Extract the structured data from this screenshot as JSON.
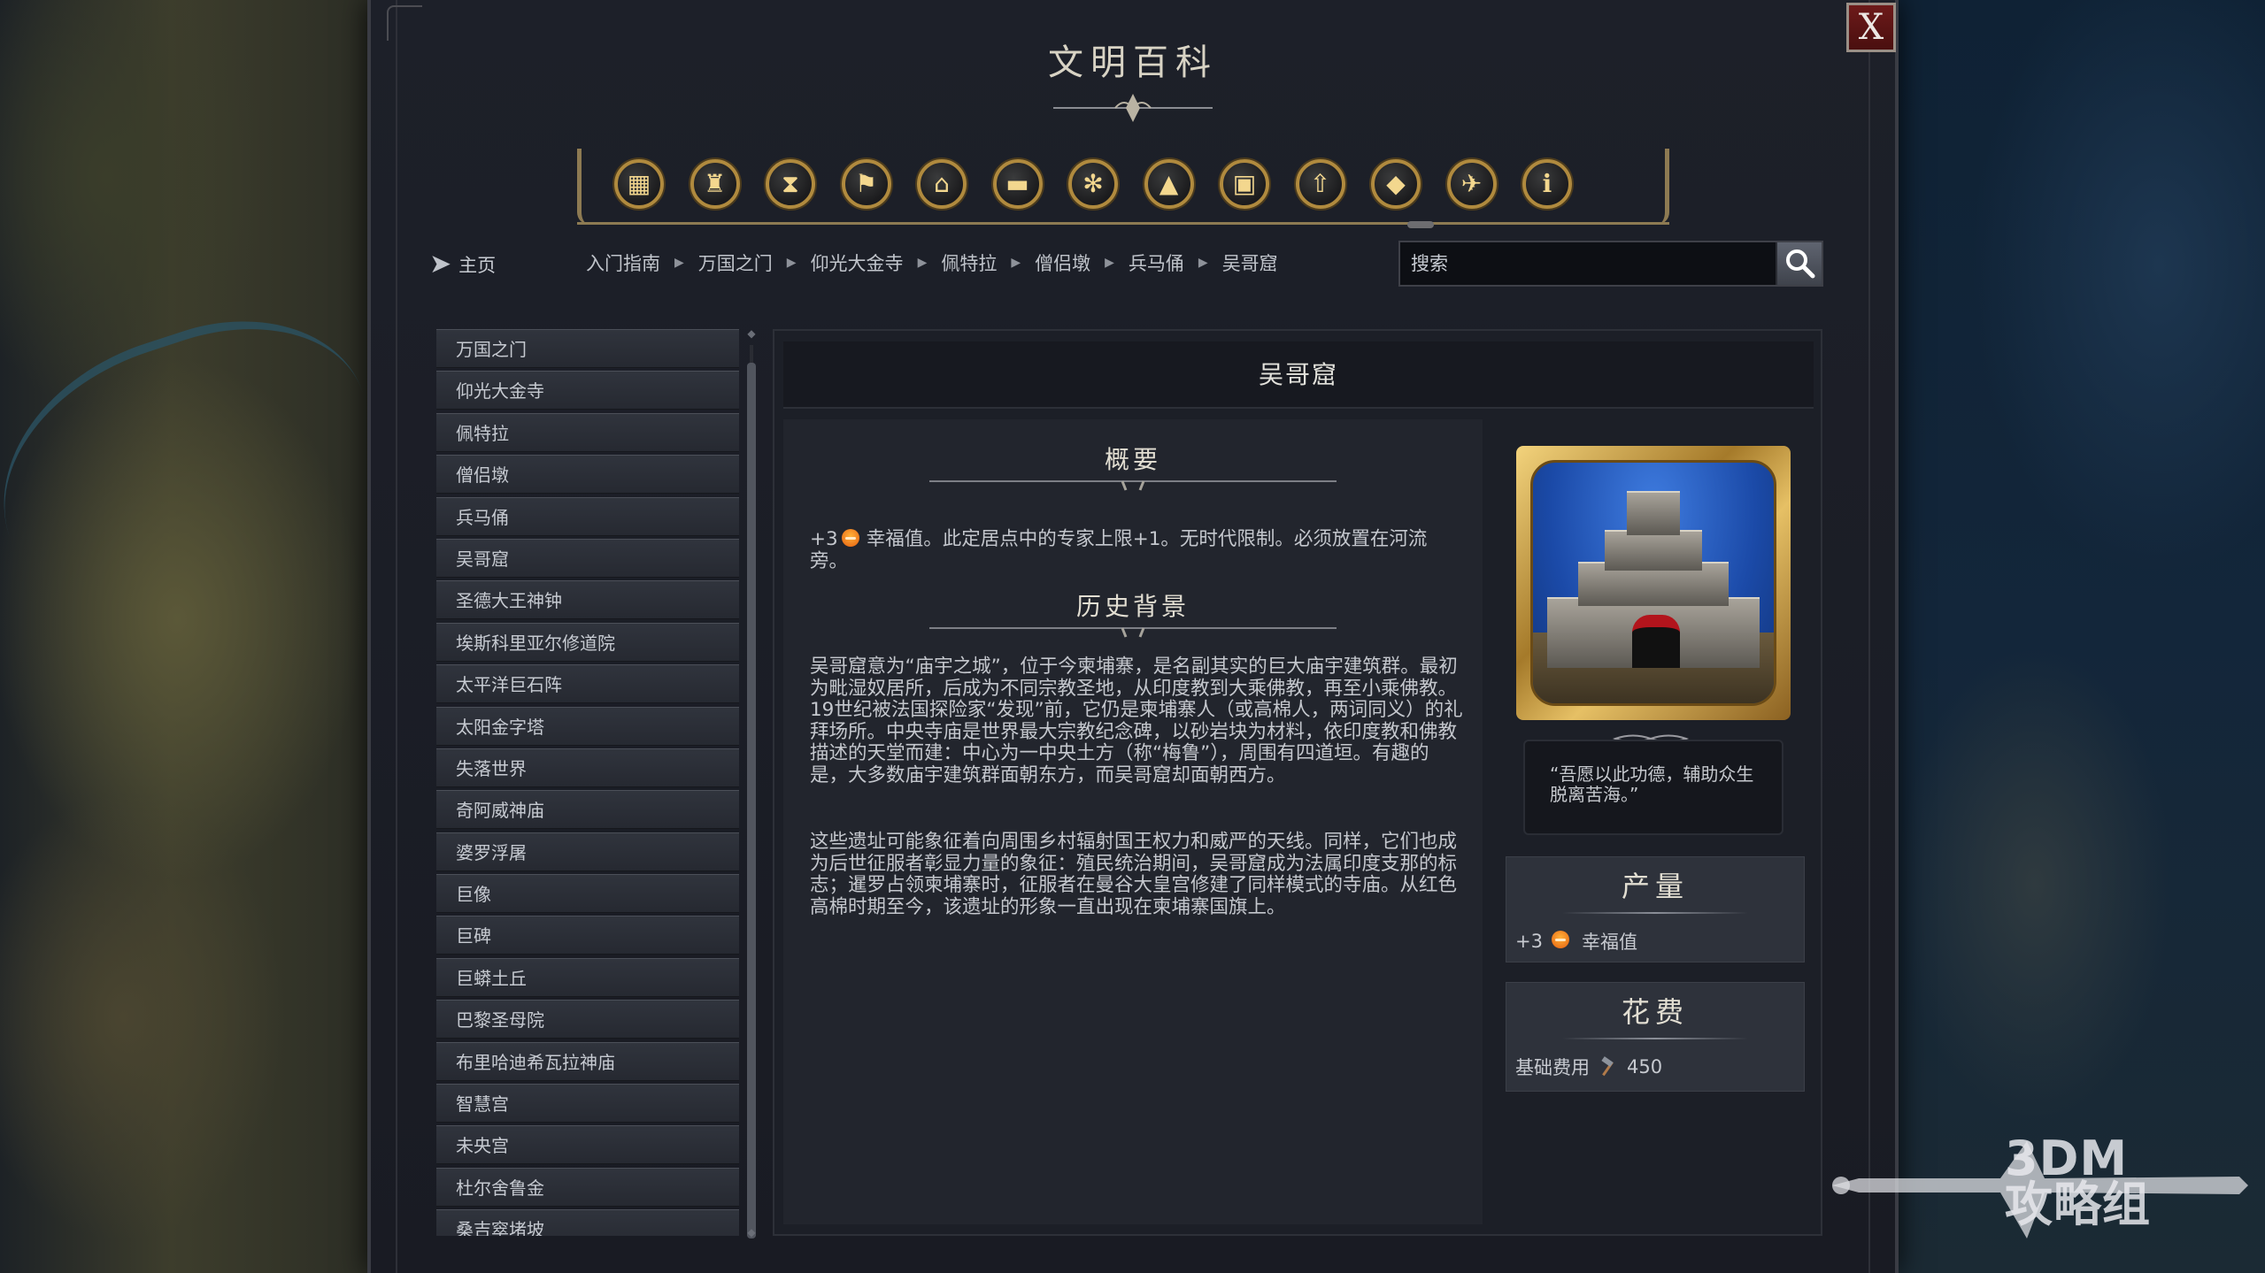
{
  "window": {
    "title": "文明百科",
    "close_label": "X"
  },
  "toolbar": {
    "categories": [
      {
        "icon": "civilization-crate-icon",
        "glyph": "▦"
      },
      {
        "icon": "leader-goblet-icon",
        "glyph": "♜"
      },
      {
        "icon": "era-hourglass-icon",
        "glyph": "⧗"
      },
      {
        "icon": "district-flag-icon",
        "glyph": "⚑"
      },
      {
        "icon": "building-temple-icon",
        "glyph": "⌂"
      },
      {
        "icon": "knowledge-book-icon",
        "glyph": "▬"
      },
      {
        "icon": "culture-emblem-icon",
        "glyph": "✻"
      },
      {
        "icon": "terrain-mountain-icon",
        "glyph": "▲"
      },
      {
        "icon": "city-tower-icon",
        "glyph": "▣"
      },
      {
        "icon": "upgrade-arrow-icon",
        "glyph": "⇧"
      },
      {
        "icon": "wonder-book-icon",
        "glyph": "◆"
      },
      {
        "icon": "dove-icon",
        "glyph": "✈"
      },
      {
        "icon": "info-icon",
        "glyph": "ℹ"
      }
    ],
    "selected_index": 10
  },
  "nav": {
    "home_label": "主页",
    "breadcrumb": [
      "入门指南",
      "万国之门",
      "仰光大金寺",
      "佩特拉",
      "僧侣墩",
      "兵马俑",
      "吴哥窟"
    ]
  },
  "search": {
    "placeholder": "搜索"
  },
  "list": {
    "items": [
      "万国之门",
      "仰光大金寺",
      "佩特拉",
      "僧侣墩",
      "兵马俑",
      "吴哥窟",
      "圣德大王神钟",
      "埃斯科里亚尔修道院",
      "太平洋巨石阵",
      "太阳金字塔",
      "失落世界",
      "奇阿威神庙",
      "婆罗浮屠",
      "巨像",
      "巨碑",
      "巨蟒土丘",
      "巴黎圣母院",
      "布里哈迪希瓦拉神庙",
      "智慧宫",
      "未央宫",
      "杜尔舍鲁金",
      "桑吉窣堵坡"
    ]
  },
  "detail": {
    "title": "吴哥窟",
    "overview_heading": "概要",
    "overview_prefix": "+3",
    "overview_text": "幸福值。此定居点中的专家上限+1。无时代限制。必须放置在河流旁。",
    "history_heading": "历史背景",
    "history_p1": "吴哥窟意为“庙宇之城”，位于今柬埔寨，是名副其实的巨大庙宇建筑群。最初为毗湿奴居所，后成为不同宗教圣地，从印度教到大乘佛教，再至小乘佛教。19世纪被法国探险家“发现”前，它仍是柬埔寨人（或高棉人，两词同义）的礼拜场所。中央寺庙是世界最大宗教纪念碑，以砂岩块为材料，依印度教和佛教描述的天堂而建：中心为一中央土方（称“梅鲁”），周围有四道垣。有趣的是，大多数庙宇建筑群面朝东方，而吴哥窟却面朝西方。",
    "history_p2": "这些遗址可能象征着向周围乡村辐射国王权力和威严的天线。同样，它们也成为后世征服者彰显力量的象征：殖民统治期间，吴哥窟成为法属印度支那的标志；暹罗占领柬埔寨时，征服者在曼谷大皇宫修建了同样模式的寺庙。从红色高棉时期至今，该遗址的形象一直出现在柬埔寨国旗上。",
    "quote": "“吾愿以此功德，辅助众生脱离苦海。”",
    "yield_heading": "产量",
    "yield_value": "+3",
    "yield_label": "幸福值",
    "cost_heading": "花费",
    "cost_label": "基础费用",
    "cost_value": "450"
  },
  "watermark": {
    "line1": "3DM",
    "line2": "攻略组"
  },
  "colors": {
    "accent_gold": "#b08a3e",
    "close_red": "#6d1a1a",
    "panel_bg": "#1c1f27"
  }
}
